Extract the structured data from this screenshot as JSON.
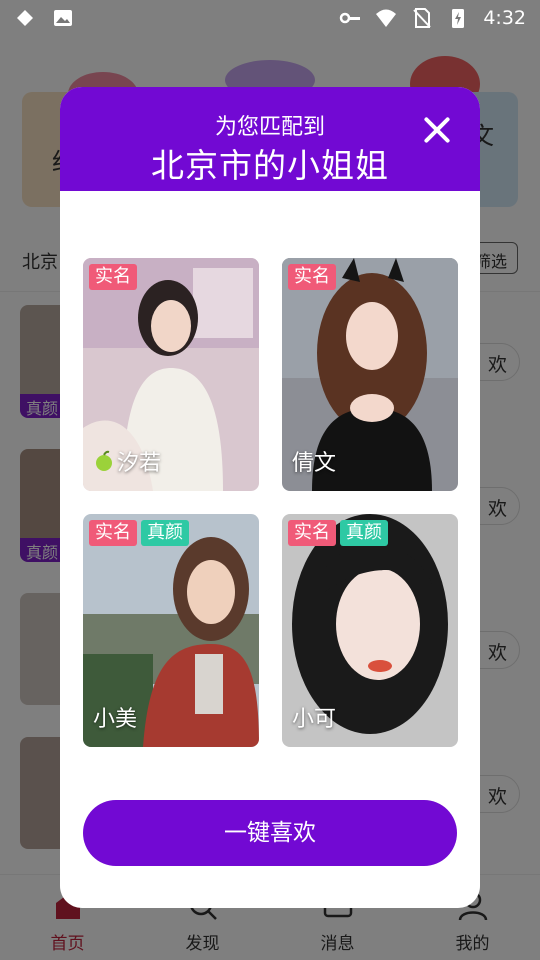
{
  "status_bar": {
    "time": "4:32",
    "icons": [
      "signal-app-icon",
      "image-icon",
      "key-icon",
      "wifi-icon",
      "no-sim-icon",
      "battery-charging-icon"
    ]
  },
  "background": {
    "banner_left_text": "红",
    "banner_right_text": "文",
    "city_filter": "北京",
    "filter_button": "筛选",
    "list_items": [
      {
        "tag": "真颜",
        "like": "欢"
      },
      {
        "tag": "真颜",
        "like": "欢"
      },
      {
        "tag": "",
        "like": "欢"
      },
      {
        "tag": "",
        "like": "欢"
      }
    ],
    "tabs": [
      {
        "label": "首页",
        "icon": "home-icon",
        "active": true
      },
      {
        "label": "发现",
        "icon": "discover-icon",
        "active": false
      },
      {
        "label": "消息",
        "icon": "message-icon",
        "active": false
      },
      {
        "label": "我的",
        "icon": "profile-icon",
        "active": false
      }
    ]
  },
  "modal": {
    "subtitle": "为您匹配到",
    "title": "北京市的小姐姐",
    "close_icon": "close-icon",
    "cards": [
      {
        "name": "汐若",
        "has_apple": true,
        "badges": [
          "实名"
        ]
      },
      {
        "name": "倩文",
        "has_apple": false,
        "badges": [
          "实名"
        ]
      },
      {
        "name": "小美",
        "has_apple": false,
        "badges": [
          "实名",
          "真颜"
        ]
      },
      {
        "name": "小可",
        "has_apple": false,
        "badges": [
          "实名",
          "真颜"
        ]
      }
    ],
    "like_all_button": "一键喜欢"
  },
  "colors": {
    "accent_purple": "#7209d3",
    "badge_real": "#f05a78",
    "badge_face": "#2ec9a4",
    "tab_active": "#c0223c"
  }
}
